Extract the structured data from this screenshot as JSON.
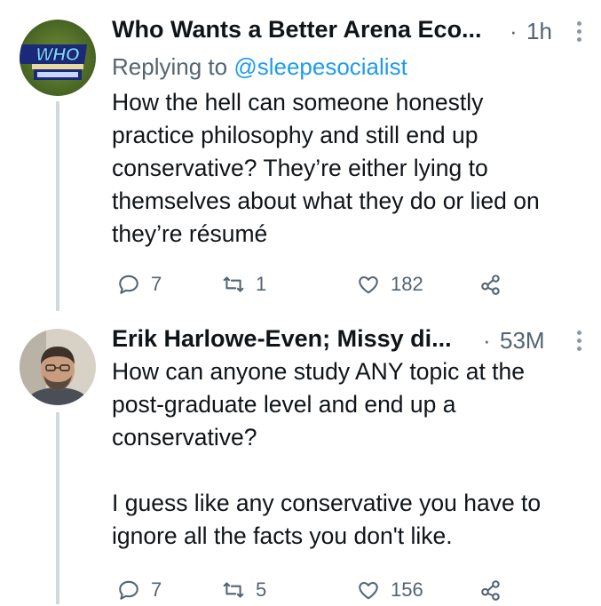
{
  "tweets": [
    {
      "author_name": "Who Wants a Better Arena Eco...",
      "time": "1h",
      "replying_prefix": "Replying to ",
      "replying_handle": "@sleepesocialist",
      "text": "How the hell can someone honestly\npractice philosophy and still end up\nconservative? They’re either lying to\nthemselves about what they do or lied on\nthey’re résumé",
      "replies": "7",
      "retweets": "1",
      "likes": "182",
      "avatar_logo_text": "WHO"
    },
    {
      "author_name": "Erik Harlowe-Even; Missy di...",
      "time": "53M",
      "text": "How can anyone study ANY topic at the\npost-graduate level and end up a\nconservative?\n\nI guess like any conservative you have to\nignore all the facts you don't like.",
      "replies": "7",
      "retweets": "5",
      "likes": "156"
    }
  ],
  "separator": "·",
  "icons": [
    "reply-icon",
    "retweet-icon",
    "like-icon",
    "share-icon",
    "more-icon"
  ],
  "colors": {
    "link": "#1d9bf0",
    "secondary": "#536471",
    "text": "#0f1419",
    "thread_line": "#cfd9de"
  }
}
